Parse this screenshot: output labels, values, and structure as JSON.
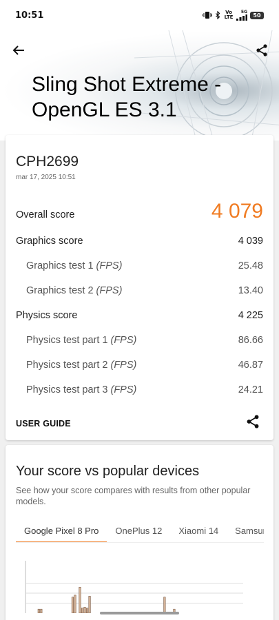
{
  "status_bar": {
    "time": "10:51",
    "volte_label": "Vo LTE",
    "network": "5G",
    "battery": "50",
    "icons": [
      "vibrate-icon",
      "bluetooth-icon",
      "volte-icon",
      "signal-icon",
      "battery-icon"
    ]
  },
  "header": {
    "back_icon": "arrow-left-icon",
    "share_icon": "share-icon",
    "title": "Sling Shot Extreme - OpenGL ES 3.1"
  },
  "result": {
    "device": "CPH2699",
    "date": "mar 17, 2025 10:51",
    "overall_label": "Overall score",
    "overall_value": "4 079",
    "graphics_label": "Graphics score",
    "graphics_value": "4 039",
    "gt1_label": "Graphics test 1",
    "gt1_value": "25.48",
    "gt2_label": "Graphics test 2",
    "gt2_value": "13.40",
    "physics_label": "Physics score",
    "physics_value": "4 225",
    "pt1_label": "Physics test part 1",
    "pt1_value": "86.66",
    "pt2_label": "Physics test part 2",
    "pt2_value": "46.87",
    "pt3_label": "Physics test part 3",
    "pt3_value": "24.21",
    "fps_unit": "(FPS)",
    "user_guide": "USER GUIDE"
  },
  "compare": {
    "title": "Your score vs popular devices",
    "subtitle": "See how your score compares with results from other popular models.",
    "tabs": [
      "Google Pixel 8 Pro",
      "OnePlus 12",
      "Xiaomi 14",
      "Samsung"
    ],
    "active_tab": 0
  },
  "colors": {
    "accent": "#f07c23",
    "bar": "#d7b59a"
  },
  "chart_data": {
    "type": "bar",
    "title": "",
    "xlabel": "",
    "ylabel": "",
    "ylim": [
      0,
      4
    ],
    "grid": true,
    "values": [
      0,
      0,
      0,
      0,
      0,
      0.4,
      0.4,
      0,
      0,
      0,
      0,
      0,
      0,
      0,
      0,
      0,
      0,
      0,
      0,
      1.6,
      1.8,
      0,
      2.6,
      0.5,
      0.6,
      0.5,
      1.7,
      0,
      0,
      0,
      0,
      0,
      0,
      0,
      0,
      0,
      0,
      0,
      0,
      0,
      0,
      0,
      0,
      0,
      0,
      0,
      0,
      0,
      0,
      0,
      0,
      0,
      0,
      0,
      0,
      0,
      0,
      1.6,
      0,
      0,
      0,
      0.4,
      0,
      0,
      0,
      0,
      0,
      0,
      0,
      0,
      0,
      0,
      0,
      0,
      0,
      0,
      0,
      0,
      0,
      0,
      0,
      0,
      0,
      0,
      0,
      0,
      0,
      0,
      0,
      0
    ]
  }
}
